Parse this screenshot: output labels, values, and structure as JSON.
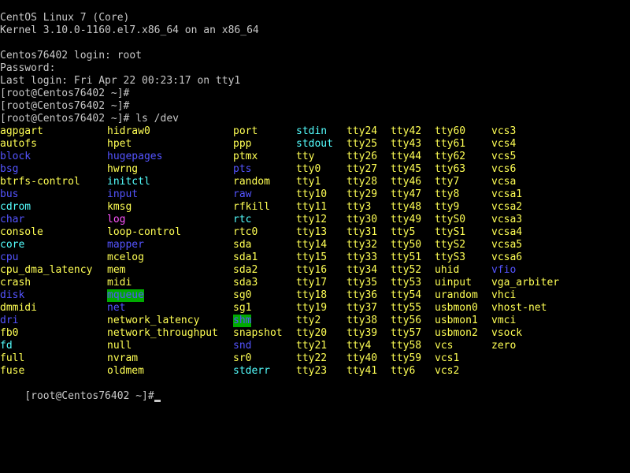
{
  "colors": {
    "background": "#000000",
    "text": "#c8c8c8",
    "file": "#ffff54",
    "directory": "#5454ff",
    "symlink": "#54ffff",
    "pipe_or_socket": "#ff54ff",
    "sticky_dir_fg": "#5454ff",
    "sticky_dir_bg": "#00aa00"
  },
  "console": {
    "header_lines": [
      "CentOS Linux 7 (Core)",
      "Kernel 3.10.0-1160.el7.x86_64 on an x86_64",
      "",
      "Centos76402 login: root",
      "Password:",
      "Last login: Fri Apr 22 00:23:17 on tty1",
      "[root@Centos76402 ~]#",
      "[root@Centos76402 ~]#",
      "[root@Centos76402 ~]# ls /dev"
    ],
    "final_prompt": "[root@Centos76402 ~]#"
  },
  "ls_listing": {
    "columns": [
      {
        "entries": [
          {
            "name": "agpgart",
            "kind": "file"
          },
          {
            "name": "autofs",
            "kind": "file"
          },
          {
            "name": "block",
            "kind": "directory"
          },
          {
            "name": "bsg",
            "kind": "directory"
          },
          {
            "name": "btrfs-control",
            "kind": "file"
          },
          {
            "name": "bus",
            "kind": "directory"
          },
          {
            "name": "cdrom",
            "kind": "symlink"
          },
          {
            "name": "char",
            "kind": "directory"
          },
          {
            "name": "console",
            "kind": "file"
          },
          {
            "name": "core",
            "kind": "symlink"
          },
          {
            "name": "cpu",
            "kind": "directory"
          },
          {
            "name": "cpu_dma_latency",
            "kind": "file"
          },
          {
            "name": "crash",
            "kind": "file"
          },
          {
            "name": "disk",
            "kind": "directory"
          },
          {
            "name": "dmmidi",
            "kind": "file"
          },
          {
            "name": "dri",
            "kind": "directory"
          },
          {
            "name": "fb0",
            "kind": "file"
          },
          {
            "name": "fd",
            "kind": "symlink"
          },
          {
            "name": "full",
            "kind": "file"
          },
          {
            "name": "fuse",
            "kind": "file"
          }
        ]
      },
      {
        "entries": [
          {
            "name": "hidraw0",
            "kind": "file"
          },
          {
            "name": "hpet",
            "kind": "file"
          },
          {
            "name": "hugepages",
            "kind": "directory"
          },
          {
            "name": "hwrng",
            "kind": "file"
          },
          {
            "name": "initctl",
            "kind": "symlink"
          },
          {
            "name": "input",
            "kind": "directory"
          },
          {
            "name": "kmsg",
            "kind": "file"
          },
          {
            "name": "log",
            "kind": "pipe_or_socket"
          },
          {
            "name": "loop-control",
            "kind": "file"
          },
          {
            "name": "mapper",
            "kind": "directory"
          },
          {
            "name": "mcelog",
            "kind": "file"
          },
          {
            "name": "mem",
            "kind": "file"
          },
          {
            "name": "midi",
            "kind": "file"
          },
          {
            "name": "mqueue",
            "kind": "sticky_dir"
          },
          {
            "name": "net",
            "kind": "directory"
          },
          {
            "name": "network_latency",
            "kind": "file"
          },
          {
            "name": "network_throughput",
            "kind": "file"
          },
          {
            "name": "null",
            "kind": "file"
          },
          {
            "name": "nvram",
            "kind": "file"
          },
          {
            "name": "oldmem",
            "kind": "file"
          }
        ]
      },
      {
        "entries": [
          {
            "name": "port",
            "kind": "file"
          },
          {
            "name": "ppp",
            "kind": "file"
          },
          {
            "name": "ptmx",
            "kind": "file"
          },
          {
            "name": "pts",
            "kind": "directory"
          },
          {
            "name": "random",
            "kind": "file"
          },
          {
            "name": "raw",
            "kind": "directory"
          },
          {
            "name": "rfkill",
            "kind": "file"
          },
          {
            "name": "rtc",
            "kind": "symlink"
          },
          {
            "name": "rtc0",
            "kind": "file"
          },
          {
            "name": "sda",
            "kind": "file"
          },
          {
            "name": "sda1",
            "kind": "file"
          },
          {
            "name": "sda2",
            "kind": "file"
          },
          {
            "name": "sda3",
            "kind": "file"
          },
          {
            "name": "sg0",
            "kind": "file"
          },
          {
            "name": "sg1",
            "kind": "file"
          },
          {
            "name": "shm",
            "kind": "sticky_dir"
          },
          {
            "name": "snapshot",
            "kind": "file"
          },
          {
            "name": "snd",
            "kind": "directory"
          },
          {
            "name": "sr0",
            "kind": "file"
          },
          {
            "name": "stderr",
            "kind": "symlink"
          }
        ]
      },
      {
        "entries": [
          {
            "name": "stdin",
            "kind": "symlink"
          },
          {
            "name": "stdout",
            "kind": "symlink"
          },
          {
            "name": "tty",
            "kind": "file"
          },
          {
            "name": "tty0",
            "kind": "file"
          },
          {
            "name": "tty1",
            "kind": "file"
          },
          {
            "name": "tty10",
            "kind": "file"
          },
          {
            "name": "tty11",
            "kind": "file"
          },
          {
            "name": "tty12",
            "kind": "file"
          },
          {
            "name": "tty13",
            "kind": "file"
          },
          {
            "name": "tty14",
            "kind": "file"
          },
          {
            "name": "tty15",
            "kind": "file"
          },
          {
            "name": "tty16",
            "kind": "file"
          },
          {
            "name": "tty17",
            "kind": "file"
          },
          {
            "name": "tty18",
            "kind": "file"
          },
          {
            "name": "tty19",
            "kind": "file"
          },
          {
            "name": "tty2",
            "kind": "file"
          },
          {
            "name": "tty20",
            "kind": "file"
          },
          {
            "name": "tty21",
            "kind": "file"
          },
          {
            "name": "tty22",
            "kind": "file"
          },
          {
            "name": "tty23",
            "kind": "file"
          }
        ]
      },
      {
        "entries": [
          {
            "name": "tty24",
            "kind": "file"
          },
          {
            "name": "tty25",
            "kind": "file"
          },
          {
            "name": "tty26",
            "kind": "file"
          },
          {
            "name": "tty27",
            "kind": "file"
          },
          {
            "name": "tty28",
            "kind": "file"
          },
          {
            "name": "tty29",
            "kind": "file"
          },
          {
            "name": "tty3",
            "kind": "file"
          },
          {
            "name": "tty30",
            "kind": "file"
          },
          {
            "name": "tty31",
            "kind": "file"
          },
          {
            "name": "tty32",
            "kind": "file"
          },
          {
            "name": "tty33",
            "kind": "file"
          },
          {
            "name": "tty34",
            "kind": "file"
          },
          {
            "name": "tty35",
            "kind": "file"
          },
          {
            "name": "tty36",
            "kind": "file"
          },
          {
            "name": "tty37",
            "kind": "file"
          },
          {
            "name": "tty38",
            "kind": "file"
          },
          {
            "name": "tty39",
            "kind": "file"
          },
          {
            "name": "tty4",
            "kind": "file"
          },
          {
            "name": "tty40",
            "kind": "file"
          },
          {
            "name": "tty41",
            "kind": "file"
          }
        ]
      },
      {
        "entries": [
          {
            "name": "tty42",
            "kind": "file"
          },
          {
            "name": "tty43",
            "kind": "file"
          },
          {
            "name": "tty44",
            "kind": "file"
          },
          {
            "name": "tty45",
            "kind": "file"
          },
          {
            "name": "tty46",
            "kind": "file"
          },
          {
            "name": "tty47",
            "kind": "file"
          },
          {
            "name": "tty48",
            "kind": "file"
          },
          {
            "name": "tty49",
            "kind": "file"
          },
          {
            "name": "tty5",
            "kind": "file"
          },
          {
            "name": "tty50",
            "kind": "file"
          },
          {
            "name": "tty51",
            "kind": "file"
          },
          {
            "name": "tty52",
            "kind": "file"
          },
          {
            "name": "tty53",
            "kind": "file"
          },
          {
            "name": "tty54",
            "kind": "file"
          },
          {
            "name": "tty55",
            "kind": "file"
          },
          {
            "name": "tty56",
            "kind": "file"
          },
          {
            "name": "tty57",
            "kind": "file"
          },
          {
            "name": "tty58",
            "kind": "file"
          },
          {
            "name": "tty59",
            "kind": "file"
          },
          {
            "name": "tty6",
            "kind": "file"
          }
        ]
      },
      {
        "entries": [
          {
            "name": "tty60",
            "kind": "file"
          },
          {
            "name": "tty61",
            "kind": "file"
          },
          {
            "name": "tty62",
            "kind": "file"
          },
          {
            "name": "tty63",
            "kind": "file"
          },
          {
            "name": "tty7",
            "kind": "file"
          },
          {
            "name": "tty8",
            "kind": "file"
          },
          {
            "name": "tty9",
            "kind": "file"
          },
          {
            "name": "ttyS0",
            "kind": "file"
          },
          {
            "name": "ttyS1",
            "kind": "file"
          },
          {
            "name": "ttyS2",
            "kind": "file"
          },
          {
            "name": "ttyS3",
            "kind": "file"
          },
          {
            "name": "uhid",
            "kind": "file"
          },
          {
            "name": "uinput",
            "kind": "file"
          },
          {
            "name": "urandom",
            "kind": "file"
          },
          {
            "name": "usbmon0",
            "kind": "file"
          },
          {
            "name": "usbmon1",
            "kind": "file"
          },
          {
            "name": "usbmon2",
            "kind": "file"
          },
          {
            "name": "vcs",
            "kind": "file"
          },
          {
            "name": "vcs1",
            "kind": "file"
          },
          {
            "name": "vcs2",
            "kind": "file"
          }
        ]
      },
      {
        "entries": [
          {
            "name": "vcs3",
            "kind": "file"
          },
          {
            "name": "vcs4",
            "kind": "file"
          },
          {
            "name": "vcs5",
            "kind": "file"
          },
          {
            "name": "vcs6",
            "kind": "file"
          },
          {
            "name": "vcsa",
            "kind": "file"
          },
          {
            "name": "vcsa1",
            "kind": "file"
          },
          {
            "name": "vcsa2",
            "kind": "file"
          },
          {
            "name": "vcsa3",
            "kind": "file"
          },
          {
            "name": "vcsa4",
            "kind": "file"
          },
          {
            "name": "vcsa5",
            "kind": "file"
          },
          {
            "name": "vcsa6",
            "kind": "file"
          },
          {
            "name": "vfio",
            "kind": "directory"
          },
          {
            "name": "vga_arbiter",
            "kind": "file"
          },
          {
            "name": "vhci",
            "kind": "file"
          },
          {
            "name": "vhost-net",
            "kind": "file"
          },
          {
            "name": "vmci",
            "kind": "file"
          },
          {
            "name": "vsock",
            "kind": "file"
          },
          {
            "name": "zero",
            "kind": "file"
          }
        ]
      }
    ]
  }
}
